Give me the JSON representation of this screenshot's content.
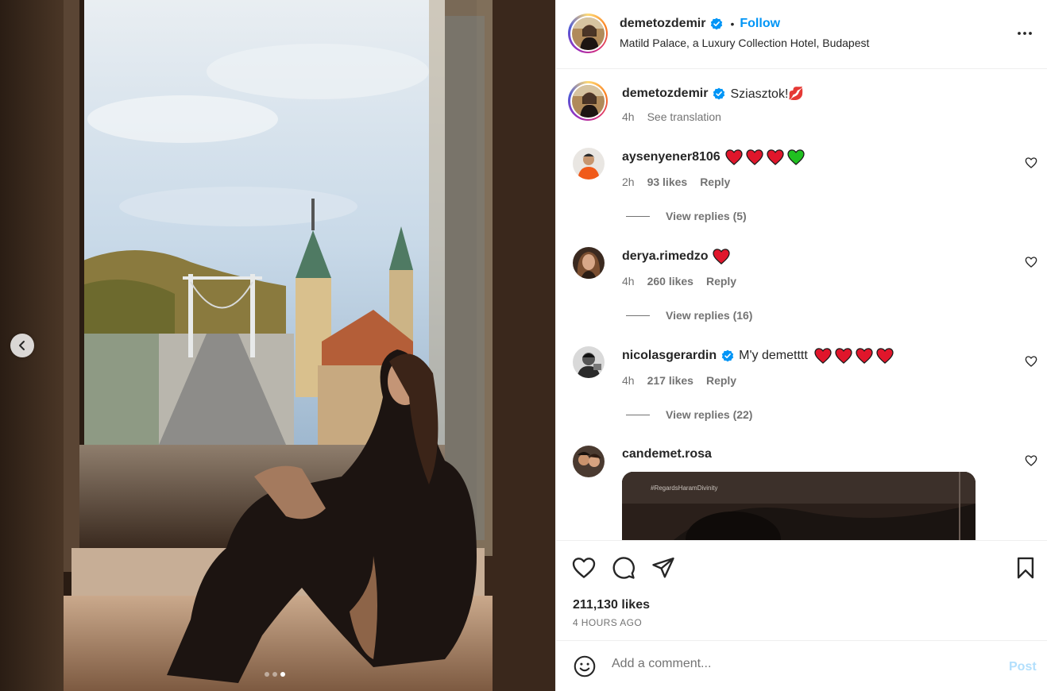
{
  "colors": {
    "accent": "#0095f6",
    "verified": "#0095f6",
    "muted": "#737373",
    "post_disabled": "#b2dffc",
    "heart_red": "#e0162b",
    "heart_green": "#20c020"
  },
  "media": {
    "carousel_total": 3,
    "carousel_active": 3,
    "prev_icon": "chevron-left-icon"
  },
  "header": {
    "username": "demetozdemir",
    "separator": "•",
    "follow_label": "Follow",
    "location": "Matild Palace, a Luxury Collection Hotel, Budapest",
    "more_icon": "more-options-icon"
  },
  "caption": {
    "username": "demetozdemir",
    "text": "Sziasztok!💋",
    "time": "4h",
    "see_translation": "See translation"
  },
  "comments": [
    {
      "username": "aysenyener8106",
      "verified": false,
      "text": "",
      "emojis": [
        "red-heart",
        "red-heart",
        "red-heart",
        "green-heart"
      ],
      "time": "2h",
      "likes": "93 likes",
      "reply": "Reply",
      "view_replies": "View replies (5)"
    },
    {
      "username": "derya.rimedzo",
      "verified": false,
      "text": "",
      "emojis": [
        "red-heart"
      ],
      "time": "4h",
      "likes": "260 likes",
      "reply": "Reply",
      "view_replies": "View replies (16)"
    },
    {
      "username": "nicolasgerardin",
      "verified": true,
      "text": "M'y demetttt",
      "emojis": [
        "red-heart",
        "red-heart",
        "red-heart",
        "red-heart"
      ],
      "time": "4h",
      "likes": "217 likes",
      "reply": "Reply",
      "view_replies": "View replies (22)"
    },
    {
      "username": "candemet.rosa",
      "verified": false,
      "text": "",
      "gif_caption": "#RegardsHaramDivinity"
    }
  ],
  "actions": {
    "like_icon": "heart-icon",
    "comment_icon": "comment-icon",
    "share_icon": "share-icon",
    "save_icon": "bookmark-icon",
    "likes": "211,130 likes",
    "time": "4 HOURS AGO"
  },
  "add_comment": {
    "emoji_icon": "emoji-icon",
    "placeholder": "Add a comment...",
    "post_label": "Post"
  }
}
